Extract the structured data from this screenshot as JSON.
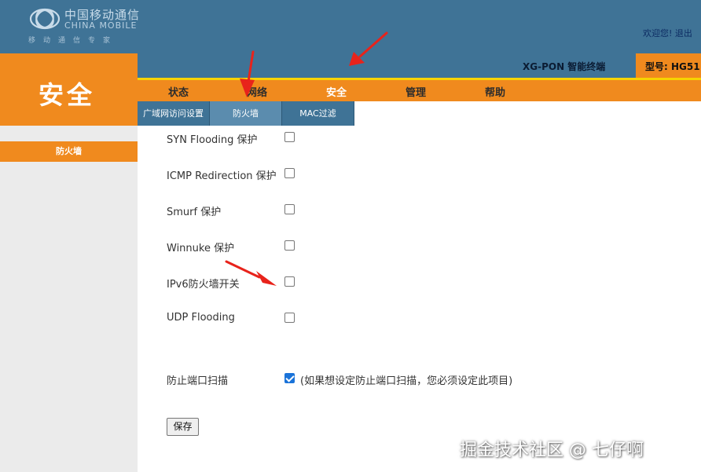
{
  "brand": {
    "cn_name": "中国移动通信",
    "en_name": "CHINA MOBILE",
    "slogan": "移动通信专家"
  },
  "header": {
    "welcome": "欢迎您!",
    "logout": "退出"
  },
  "product": {
    "name": "XG-PON 智能终端",
    "model_label": "型号: HG51"
  },
  "section": {
    "title": "安全"
  },
  "main_nav": {
    "items": [
      {
        "label": "状态",
        "active": false
      },
      {
        "label": "网络",
        "active": false
      },
      {
        "label": "安全",
        "active": true
      },
      {
        "label": "管理",
        "active": false
      },
      {
        "label": "帮助",
        "active": false
      }
    ]
  },
  "sub_nav": {
    "tabs": [
      {
        "label": "广域网访问设置",
        "active": false
      },
      {
        "label": "防火墙",
        "active": true
      },
      {
        "label": "MAC过滤",
        "active": false
      }
    ]
  },
  "sidebar": {
    "items": [
      {
        "label": "防火墙",
        "active": true
      }
    ]
  },
  "firewall": {
    "options": [
      {
        "label": "SYN Flooding 保护",
        "checked": false
      },
      {
        "label": "ICMP Redirection 保护",
        "checked": false
      },
      {
        "label": "Smurf 保护",
        "checked": false
      },
      {
        "label": "Winnuke 保护",
        "checked": false
      },
      {
        "label": "IPv6防火墙开关",
        "checked": false
      },
      {
        "label": "UDP Flooding",
        "checked": false
      }
    ],
    "port_scan": {
      "label": "防止端口扫描",
      "checked": true,
      "note": "(如果想设定防止端口扫描，您必须设定此项目)"
    },
    "save_label": "保存"
  },
  "watermark": "掘金技术社区 @ 七仔啊",
  "colors": {
    "header_blue": "#3f7396",
    "accent_orange": "#f08a1e",
    "accent_yellow": "#f7d300",
    "annotation_red": "#e8231b"
  }
}
